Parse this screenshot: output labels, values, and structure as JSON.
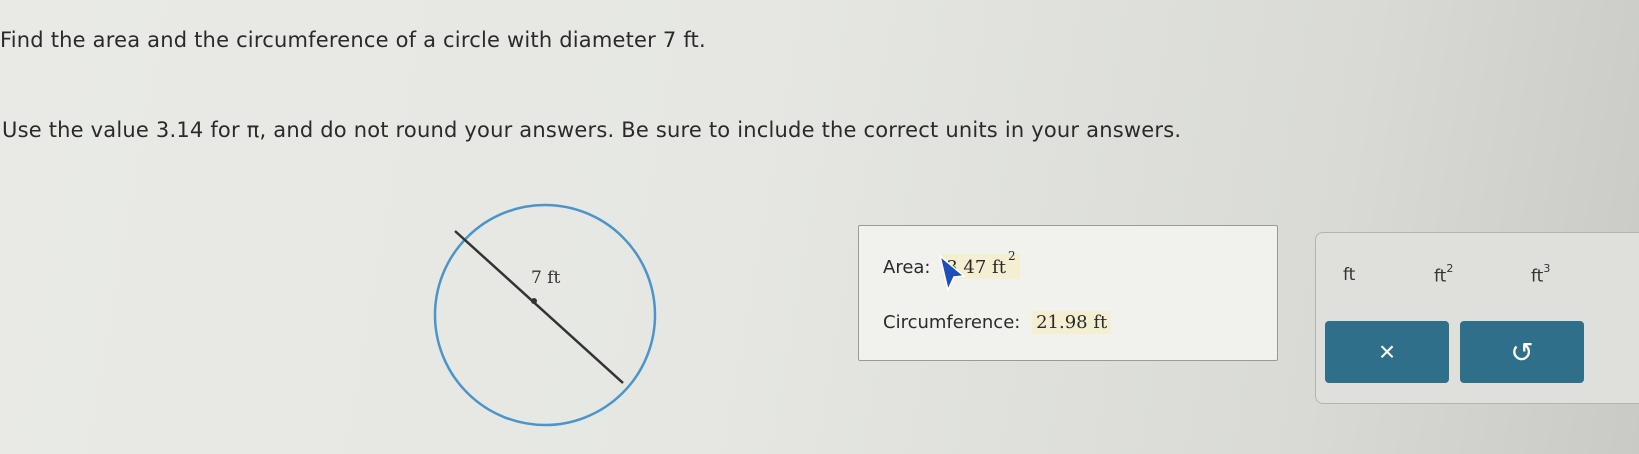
{
  "question": {
    "line1": "Find the area and the circumference of a circle with diameter 7 ft.",
    "line2": "Use the value 3.14 for π, and do not round your answers. Be sure to include the correct units in your answers."
  },
  "figure": {
    "diameter_label": "7 ft",
    "circle_color": "#4a95c9"
  },
  "answers": {
    "area_label": "Area:",
    "area_value": "3 47 ft",
    "area_exponent": "2",
    "circumference_label": "Circumference:",
    "circumference_value": "21.98 ft"
  },
  "units": {
    "ft": "ft",
    "ft2_base": "ft",
    "ft2_exp": "2",
    "ft3_base": "ft",
    "ft3_exp": "3"
  },
  "actions": {
    "clear_icon": "close-icon",
    "clear_symbol": "×",
    "undo_icon": "undo-icon",
    "undo_symbol": "↺",
    "button_color": "#2f6f89"
  }
}
